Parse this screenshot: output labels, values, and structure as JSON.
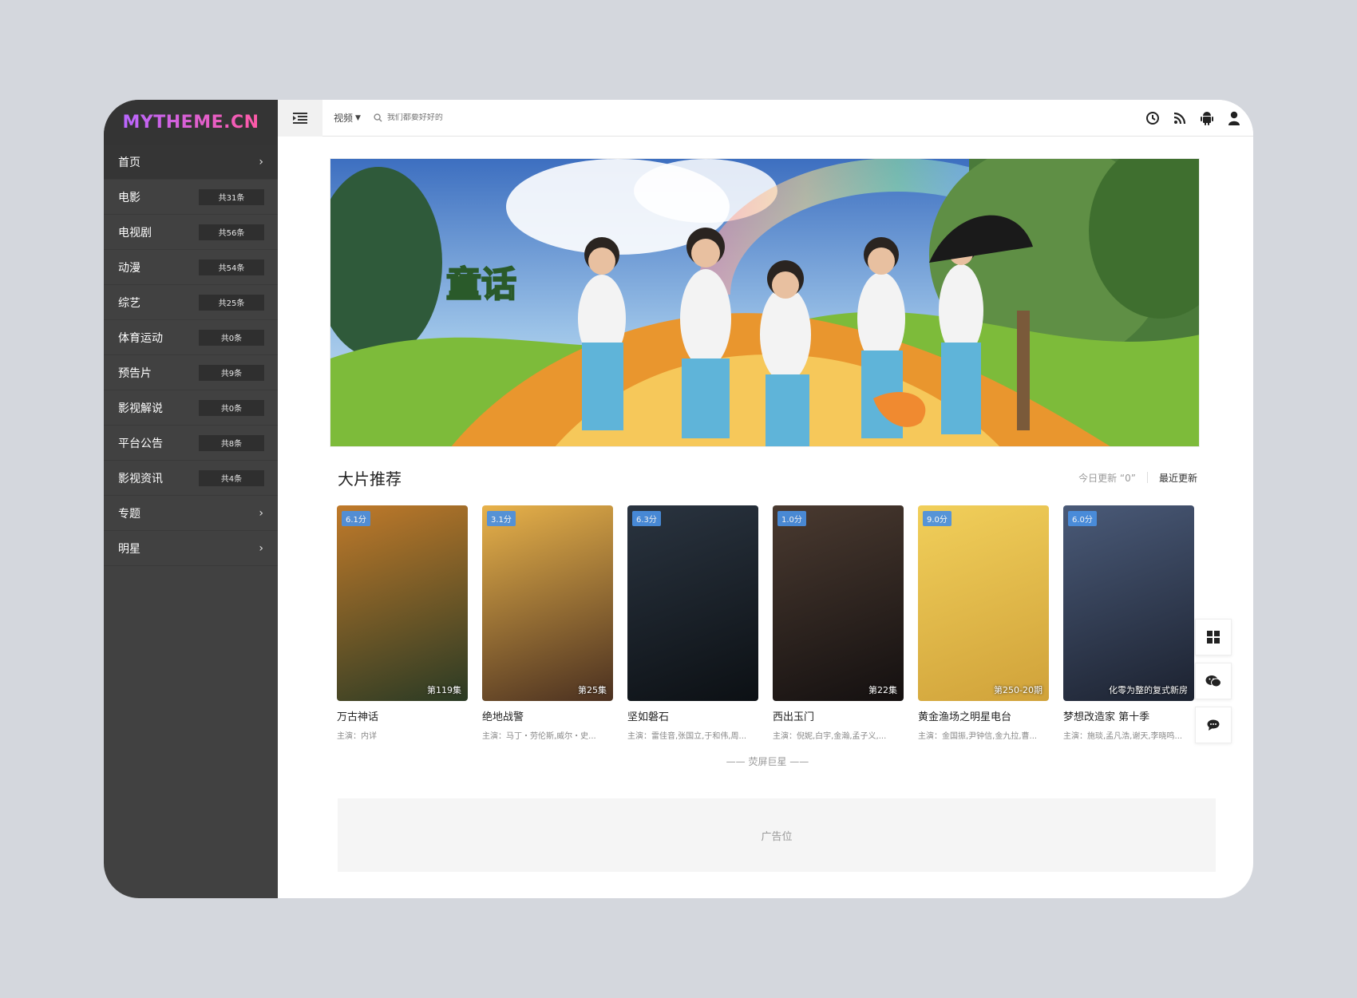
{
  "app": {
    "logo": "MYTHEME.CN"
  },
  "sidebar": {
    "items": [
      {
        "label": "首页",
        "badge": "",
        "chevron": "›"
      },
      {
        "label": "电影",
        "badge": "共31条",
        "chevron": ""
      },
      {
        "label": "电视剧",
        "badge": "共56条",
        "chevron": ""
      },
      {
        "label": "动漫",
        "badge": "共54条",
        "chevron": ""
      },
      {
        "label": "综艺",
        "badge": "共25条",
        "chevron": ""
      },
      {
        "label": "体育运动",
        "badge": "共0条",
        "chevron": ""
      },
      {
        "label": "预告片",
        "badge": "共9条",
        "chevron": ""
      },
      {
        "label": "影视解说",
        "badge": "共0条",
        "chevron": ""
      },
      {
        "label": "平台公告",
        "badge": "共8条",
        "chevron": ""
      },
      {
        "label": "影视资讯",
        "badge": "共4条",
        "chevron": ""
      },
      {
        "label": "专题",
        "badge": "",
        "chevron": "›"
      },
      {
        "label": "明星",
        "badge": "",
        "chevron": "›"
      }
    ]
  },
  "topbar": {
    "search_type": "视频",
    "search_placeholder": "我们都要好好的",
    "icons": [
      "history-icon",
      "rss-icon",
      "android-icon",
      "user-icon"
    ]
  },
  "section": {
    "title": "大片推荐",
    "today_update": "今日更新 “0”",
    "recent_update": "最近更新"
  },
  "cards": [
    {
      "title": "万古神话",
      "actors": "主演：内详",
      "rating": "6.1分",
      "episode": "第119集",
      "c1": "#c07a2a",
      "c2": "#2a3a24"
    },
    {
      "title": "绝地战警",
      "actors": "主演：马丁・劳伦斯,威尔・史...",
      "rating": "3.1分",
      "episode": "第25集",
      "c1": "#e8b24a",
      "c2": "#4a3020"
    },
    {
      "title": "坚如磐石",
      "actors": "主演：雷佳音,张国立,于和伟,周...",
      "rating": "6.3分",
      "episode": "",
      "c1": "#2a3440",
      "c2": "#0c1014"
    },
    {
      "title": "西出玉门",
      "actors": "主演：倪妮,白宇,金瀚,孟子义,...",
      "rating": "1.0分",
      "episode": "第22集",
      "c1": "#4a3a30",
      "c2": "#141010"
    },
    {
      "title": "黄金渔场之明星电台",
      "actors": "主演：金国振,尹钟信,金九拉,曹...",
      "rating": "9.0分",
      "episode": "第250-20期",
      "c1": "#f1cf5a",
      "c2": "#d0a23a"
    },
    {
      "title": "梦想改造家 第十季",
      "actors": "主演：施琰,孟凡浩,谢天,李晓鸣...",
      "rating": "6.0分",
      "episode": "化零为整的复式新房",
      "c1": "#4a5a78",
      "c2": "#1c2230"
    }
  ],
  "subsection": {
    "title": "—— 荧屏巨星 ——"
  },
  "ad": {
    "label": "广告位"
  },
  "banner": {
    "title_text": "童话"
  },
  "float_buttons": [
    "windows-icon",
    "wechat-icon",
    "comment-icon"
  ],
  "colors": {
    "sidebar_bg": "#414141",
    "accent": "#4a90e2"
  }
}
